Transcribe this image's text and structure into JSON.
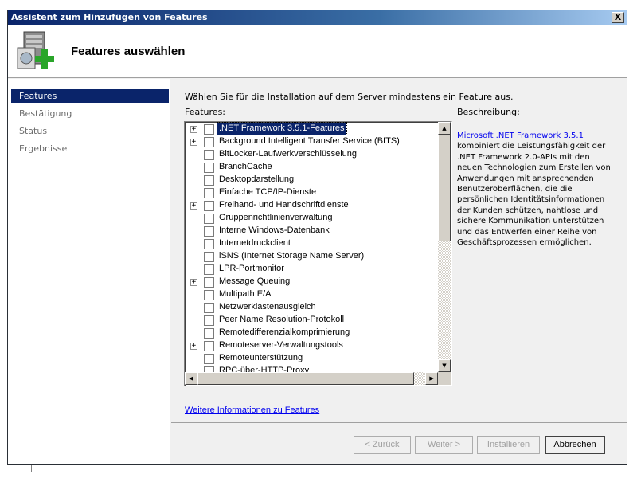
{
  "window": {
    "title": "Assistent zum Hinzufügen von Features",
    "close_label": "X"
  },
  "header": {
    "title": "Features auswählen",
    "icon": "server-add-icon"
  },
  "sidebar": {
    "items": [
      {
        "label": "Features",
        "active": true
      },
      {
        "label": "Bestätigung",
        "active": false
      },
      {
        "label": "Status",
        "active": false
      },
      {
        "label": "Ergebnisse",
        "active": false
      }
    ]
  },
  "main": {
    "instruction": "Wählen Sie für die Installation auf dem Server mindestens ein Feature aus.",
    "features_label": "Features:",
    "description_label": "Beschreibung:",
    "description_link": "Microsoft .NET Framework 3.5.1",
    "description_text": "kombiniert die Leistungsfähigkeit der .NET Framework 2.0-APIs mit den neuen Technologien zum Erstellen von Anwendungen mit ansprechenden Benutzeroberflächen, die die persönlichen Identitätsinformationen der Kunden schützen, nahtlose und sichere Kommunikation unterstützen und das Entwerfen einer Reihe von Geschäftsprozessen ermöglichen.",
    "more_info_link": "Weitere Informationen zu Features",
    "features": [
      {
        "label": ".NET Framework 3.5.1-Features",
        "expandable": true,
        "selected": true,
        "checked": false
      },
      {
        "label": "Background Intelligent Transfer Service (BITS)",
        "expandable": true,
        "selected": false,
        "checked": false
      },
      {
        "label": "BitLocker-Laufwerkverschlüsselung",
        "expandable": false,
        "selected": false,
        "checked": false
      },
      {
        "label": "BranchCache",
        "expandable": false,
        "selected": false,
        "checked": false
      },
      {
        "label": "Desktopdarstellung",
        "expandable": false,
        "selected": false,
        "checked": false
      },
      {
        "label": "Einfache TCP/IP-Dienste",
        "expandable": false,
        "selected": false,
        "checked": false
      },
      {
        "label": "Freihand- und Handschriftdienste",
        "expandable": true,
        "selected": false,
        "checked": false
      },
      {
        "label": "Gruppenrichtlinienverwaltung",
        "expandable": false,
        "selected": false,
        "checked": false
      },
      {
        "label": "Interne Windows-Datenbank",
        "expandable": false,
        "selected": false,
        "checked": false
      },
      {
        "label": "Internetdruckclient",
        "expandable": false,
        "selected": false,
        "checked": false
      },
      {
        "label": "iSNS (Internet Storage Name Server)",
        "expandable": false,
        "selected": false,
        "checked": false
      },
      {
        "label": "LPR-Portmonitor",
        "expandable": false,
        "selected": false,
        "checked": false
      },
      {
        "label": "Message Queuing",
        "expandable": true,
        "selected": false,
        "checked": false
      },
      {
        "label": "Multipath E/A",
        "expandable": false,
        "selected": false,
        "checked": false
      },
      {
        "label": "Netzwerklastenausgleich",
        "expandable": false,
        "selected": false,
        "checked": false
      },
      {
        "label": "Peer Name Resolution-Protokoll",
        "expandable": false,
        "selected": false,
        "checked": false
      },
      {
        "label": "Remotedifferenzialkomprimierung",
        "expandable": false,
        "selected": false,
        "checked": false
      },
      {
        "label": "Remoteserver-Verwaltungstools",
        "expandable": true,
        "selected": false,
        "checked": false
      },
      {
        "label": "Remoteunterstützung",
        "expandable": false,
        "selected": false,
        "checked": false
      },
      {
        "label": "RPC-über-HTTP-Proxy",
        "expandable": false,
        "selected": false,
        "checked": false
      }
    ]
  },
  "footer": {
    "back_label": "< Zurück",
    "next_label": "Weiter >",
    "install_label": "Installieren",
    "cancel_label": "Abbrechen"
  },
  "colors": {
    "titlebar": "#0a246a",
    "selection": "#0a246a",
    "link": "#0000ee"
  }
}
